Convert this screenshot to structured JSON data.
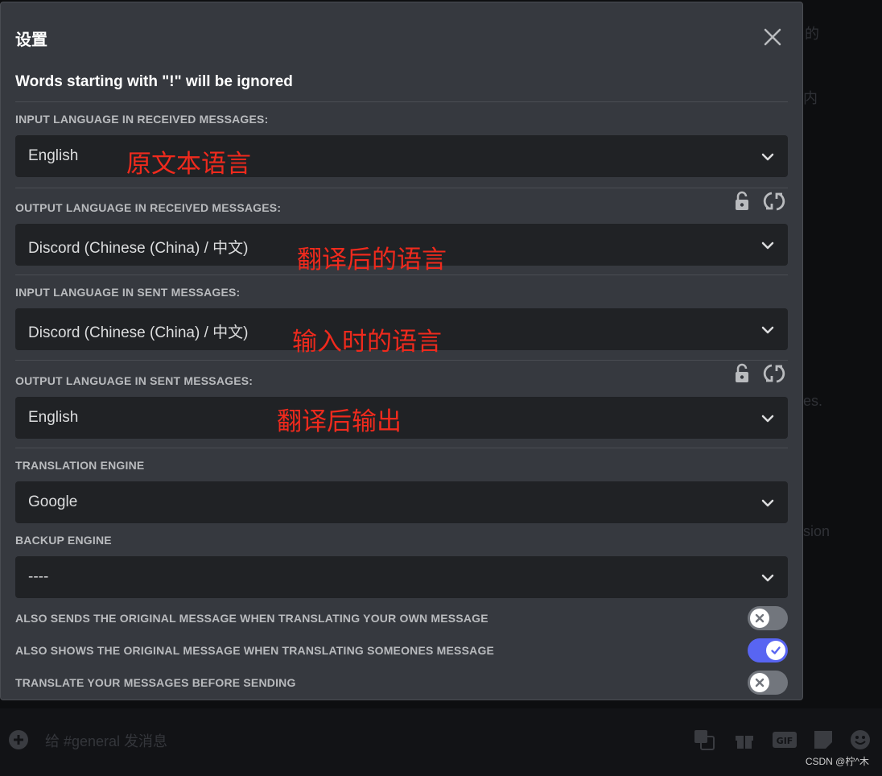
{
  "background": {
    "fragments": [
      "的",
      "内",
      "es.",
      "sion"
    ],
    "chat_placeholder": "给 #general 发消息",
    "gif_label": "GIF"
  },
  "watermark": "CSDN @柠^木",
  "modal": {
    "title": "设置",
    "notice": "Words starting with \"!\" will be ignored",
    "fields": [
      {
        "label": "INPUT LANGUAGE IN RECEIVED MESSAGES:",
        "value": "English",
        "annotation": "原文本语言"
      },
      {
        "label": "OUTPUT LANGUAGE IN RECEIVED MESSAGES:",
        "value": "Discord (Chinese (China) / 中文)",
        "annotation": "翻译后的语言"
      },
      {
        "label": "INPUT LANGUAGE IN SENT MESSAGES:",
        "value": "Discord (Chinese (China) / 中文)",
        "annotation": "输入时的语言"
      },
      {
        "label": "OUTPUT LANGUAGE IN SENT MESSAGES:",
        "value": "English",
        "annotation": "翻译后输出"
      }
    ],
    "engine": {
      "label": "TRANSLATION ENGINE",
      "value": "Google"
    },
    "backup_engine": {
      "label": "BACKUP ENGINE",
      "value": "----"
    },
    "toggles": [
      {
        "label": "ALSO SENDS THE ORIGINAL MESSAGE WHEN TRANSLATING YOUR OWN MESSAGE",
        "enabled": false
      },
      {
        "label": "ALSO SHOWS THE ORIGINAL MESSAGE WHEN TRANSLATING SOMEONES MESSAGE",
        "enabled": true
      },
      {
        "label": "TRANSLATE YOUR MESSAGES BEFORE SENDING",
        "enabled": false
      }
    ]
  },
  "colors": {
    "modal_bg": "#36393f",
    "select_bg": "#202225",
    "toggle_on": "#5865f2",
    "toggle_off": "#72767d",
    "annotation_red": "#ef2a1d"
  },
  "icons": [
    "close-icon",
    "chevron-down-icon",
    "lock-icon",
    "swap-icon",
    "check-icon",
    "x-icon",
    "add-icon",
    "translate-icon",
    "gift-icon",
    "gif-icon",
    "sticker-icon",
    "emoji-icon"
  ]
}
